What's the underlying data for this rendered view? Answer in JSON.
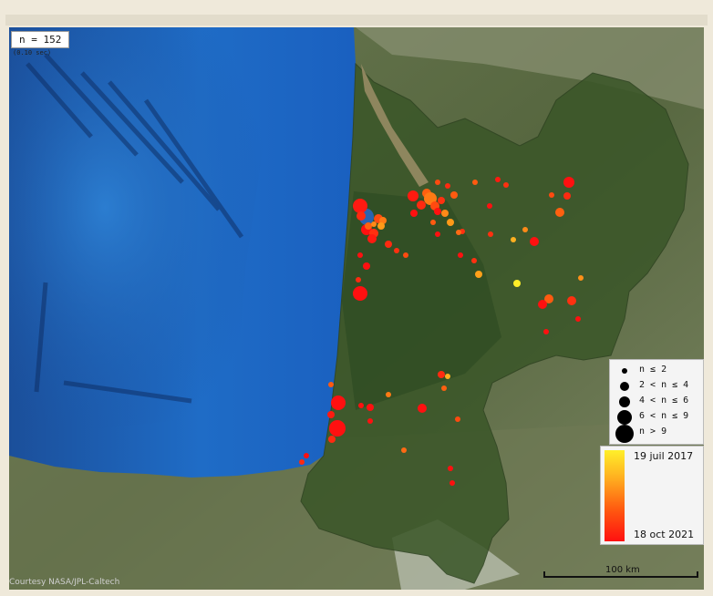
{
  "map": {
    "count_label": "n = 152",
    "timing_label": "(0.10 sec)",
    "credit": "Courtesy NASA/JPL-Caltech",
    "scale_label": "100 km",
    "size_legend": [
      {
        "label": "n ≤ 2"
      },
      {
        "label": "2 < n ≤ 4"
      },
      {
        "label": "4 < n ≤ 6"
      },
      {
        "label": "6 < n ≤ 9"
      },
      {
        "label": "n > 9"
      }
    ],
    "time_legend": {
      "start": "19 juil 2017",
      "end": "18 oct 2021",
      "start_color": "#ffef2a",
      "end_color": "#ff1010"
    },
    "colors": {
      "ocean": "#1f63b8",
      "land": "#3d5a2c",
      "region_overlay": "#37522a"
    }
  }
}
